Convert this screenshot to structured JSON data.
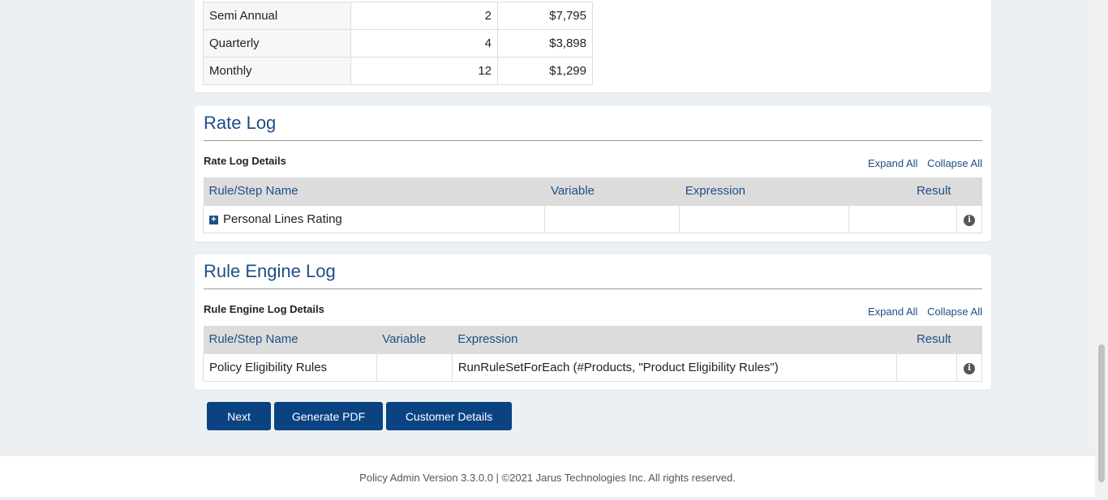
{
  "payment_schedule": {
    "rows": [
      {
        "plan": "Semi Annual",
        "installments": "2",
        "amount": "$7,795"
      },
      {
        "plan": "Quarterly",
        "installments": "4",
        "amount": "$3,898"
      },
      {
        "plan": "Monthly",
        "installments": "12",
        "amount": "$1,299"
      }
    ]
  },
  "rate_log": {
    "title": "Rate Log",
    "subtitle": "Rate Log Details",
    "expand_all": "Expand All",
    "collapse_all": "Collapse All",
    "columns": {
      "name": "Rule/Step Name",
      "variable": "Variable",
      "expression": "Expression",
      "result": "Result"
    },
    "rows": [
      {
        "name": "Personal Lines Rating",
        "variable": "",
        "expression": "",
        "result": ""
      }
    ]
  },
  "rule_engine_log": {
    "title": "Rule Engine Log",
    "subtitle": "Rule Engine Log Details",
    "expand_all": "Expand All",
    "collapse_all": "Collapse All",
    "columns": {
      "name": "Rule/Step Name",
      "variable": "Variable",
      "expression": "Expression",
      "result": "Result"
    },
    "rows": [
      {
        "name": "Policy Eligibility Rules",
        "variable": "",
        "expression": "RunRuleSetForEach (#Products, \"Product Eligibility Rules\")",
        "result": ""
      }
    ]
  },
  "buttons": {
    "next": "Next",
    "generate_pdf": "Generate PDF",
    "customer_details": "Customer Details"
  },
  "icons": {
    "info": "info-icon",
    "expand": "plus-square-icon"
  },
  "footer": {
    "text": "Policy Admin Version 3.3.0.0 | ©2021 Jarus Technologies Inc. All rights reserved."
  },
  "colors": {
    "accent": "#1f4e86",
    "button": "#0b4382",
    "header_bg": "#dcdcdc",
    "page_bg": "#edf0f2"
  }
}
